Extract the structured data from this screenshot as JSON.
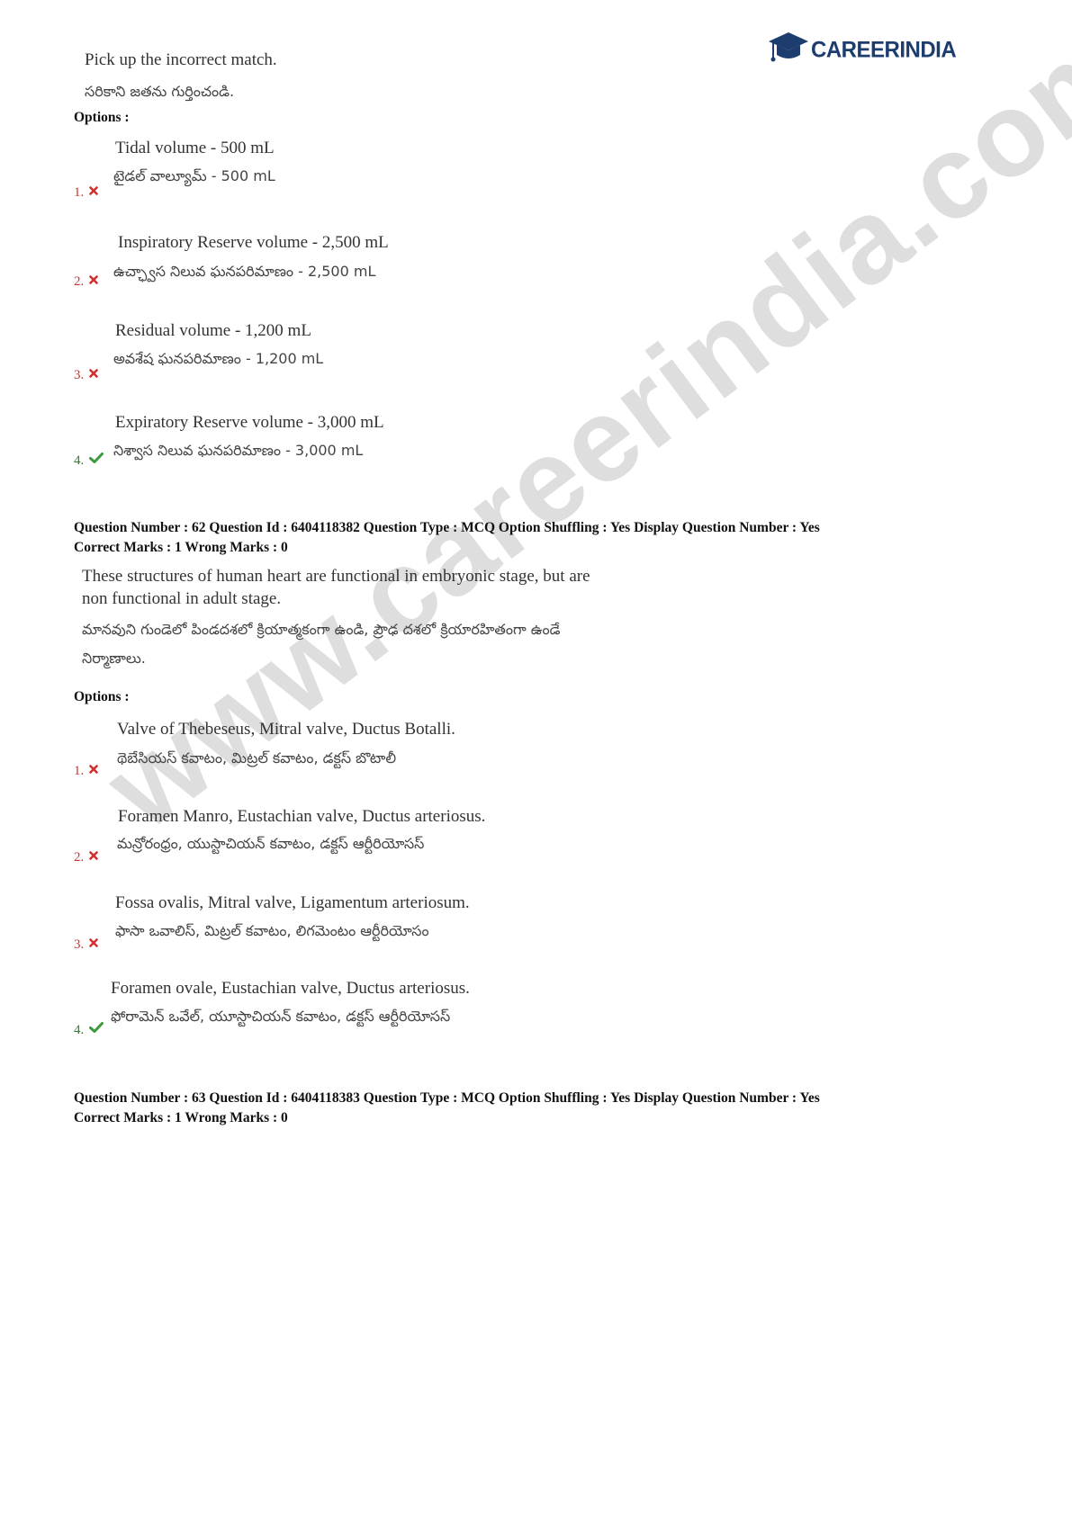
{
  "logo": {
    "text_main": "CAREER",
    "text_accent": "INDIA",
    "icon": "graduation-cap-icon"
  },
  "watermark": {
    "text": "www.careerindia.com"
  },
  "block1": {
    "question_en": "Pick up the incorrect match.",
    "question_te": "సరికాని జతను గుర్తించండి.",
    "options_label": "Options :",
    "options": [
      {
        "num": "1.",
        "en": "Tidal volume - 500 mL",
        "te": "టైడల్ వాల్యూమ్ -  500 mL",
        "status": "wrong",
        "icon": "cross-icon"
      },
      {
        "num": "2.",
        "en": "Inspiratory Reserve volume - 2,500 mL",
        "te": "ఉచ్ఛ్వాస నిలువ ఘనపరిమాణం -  2,500 mL",
        "status": "wrong",
        "icon": "cross-icon"
      },
      {
        "num": "3.",
        "en": "Residual volume  - 1,200 mL",
        "te": "అవశేష ఘనపరిమాణం -  1,200 mL",
        "status": "wrong",
        "icon": "cross-icon"
      },
      {
        "num": "4.",
        "en": "Expiratory Reserve volume - 3,000 mL",
        "te": "నిశ్వాస నిలువ ఘనపరిమాణం  - 3,000 mL",
        "status": "correct",
        "icon": "check-icon"
      }
    ]
  },
  "q62": {
    "meta_line1": "Question Number : 62 Question Id : 6404118382 Question Type : MCQ Option Shuffling : Yes Display Question Number : Yes",
    "meta_line2": "Correct Marks : 1 Wrong Marks : 0",
    "question_en_line1": "These structures of human heart are functional in embryonic stage, but are",
    "question_en_line2": "non functional in adult stage.",
    "question_te_line1": "మానవుని గుండెలో పిండదశలో క్రియాత్మకంగా ఉండి, ప్రౌఢ దశలో క్రియారహితంగా ఉండే",
    "question_te_line2": "నిర్మాణాలు.",
    "options_label": "Options :",
    "options": [
      {
        "num": "1.",
        "en": "Valve of Thebeseus, Mitral valve, Ductus Botalli.",
        "te": "థెబేసియస్ కవాటం, మిట్రల్ కవాటం, డక్టస్ బొటాలీ",
        "status": "wrong",
        "icon": "cross-icon"
      },
      {
        "num": "2.",
        "en": "Foramen Manro, Eustachian valve, Ductus arteriosus.",
        "te": "మన్రోరంధ్రం, యుస్టాచియన్ కవాటం, డక్టస్ ఆర్టీరియోసస్",
        "status": "wrong",
        "icon": "cross-icon"
      },
      {
        "num": "3.",
        "en": "Fossa ovalis, Mitral valve, Ligamentum arteriosum.",
        "te": "ఫాసా ఒవాలిస్, మిట్రల్ కవాటం, లిగమెంటం ఆర్టీరియోసం",
        "status": "wrong",
        "icon": "cross-icon"
      },
      {
        "num": "4.",
        "en": "Foramen ovale, Eustachian valve, Ductus arteriosus.",
        "te": "ఫోరామెన్ ఒవేల్, యూస్టాచియన్ కవాటం, డక్టస్ ఆర్టీరియోసస్",
        "status": "correct",
        "icon": "check-icon"
      }
    ]
  },
  "q63": {
    "meta_line1": "Question Number : 63 Question Id : 6404118383 Question Type : MCQ Option Shuffling : Yes Display Question Number : Yes",
    "meta_line2": "Correct Marks : 1 Wrong Marks : 0"
  },
  "colors": {
    "wrong": "#d32f2f",
    "correct": "#2e7d32",
    "logo": "#1c3d6e",
    "watermark": "#dedede"
  }
}
